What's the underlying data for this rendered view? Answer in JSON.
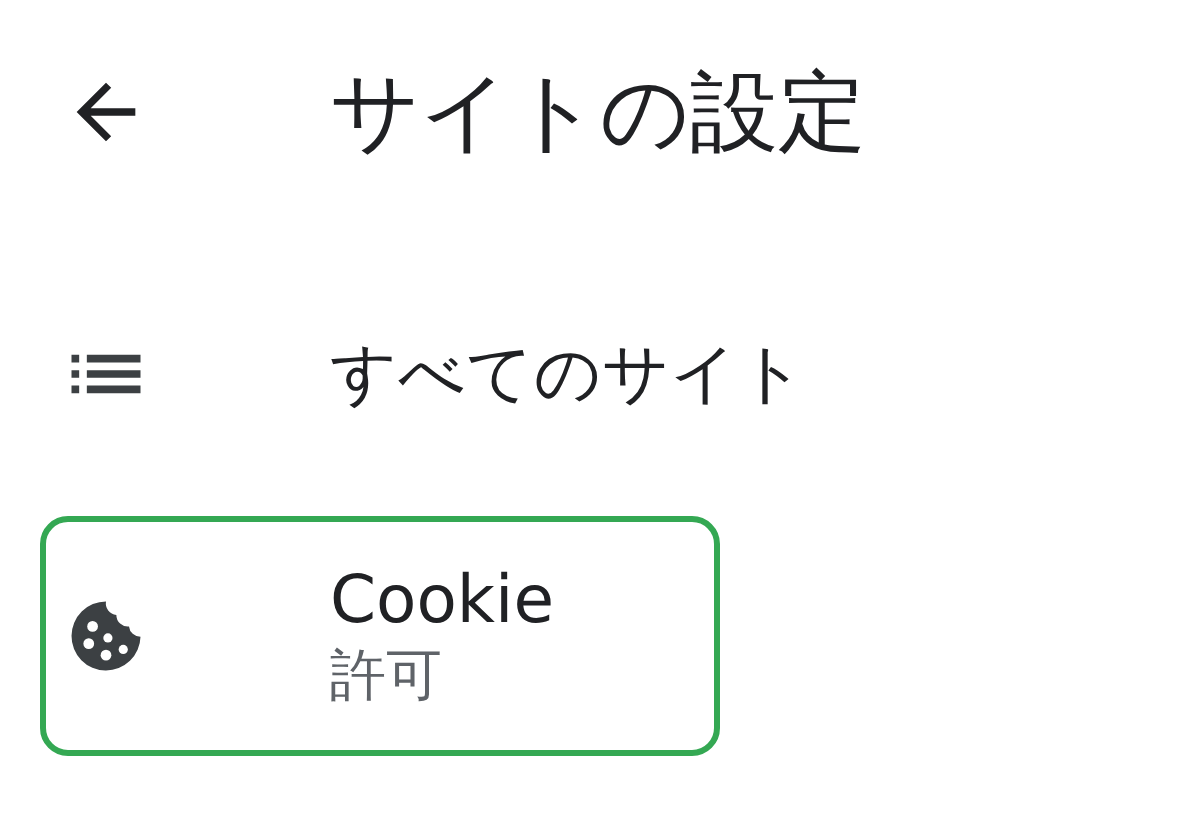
{
  "header": {
    "title": "サイトの設定"
  },
  "items": [
    {
      "kind": "sites",
      "label": "すべてのサイト",
      "highlighted": false
    },
    {
      "kind": "cookie",
      "label": "Cookie",
      "subtitle": "許可",
      "highlighted": true
    }
  ]
}
